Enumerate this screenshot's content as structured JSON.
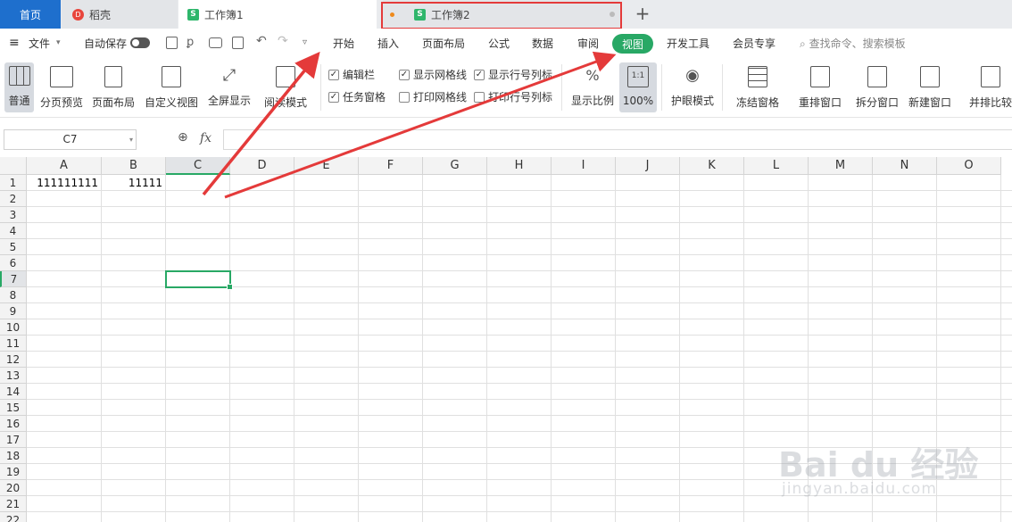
{
  "tabs": {
    "home": "首页",
    "daoke": "稻壳",
    "wb1": "工作簿1",
    "wb2": "工作簿2",
    "add": "+"
  },
  "menu": {
    "file": "文件",
    "autosave": "自动保存",
    "items": [
      "开始",
      "插入",
      "页面布局",
      "公式",
      "数据",
      "审阅",
      "视图",
      "开发工具",
      "会员专享"
    ],
    "search": "查找命令、搜索模板"
  },
  "ribbon": {
    "buttons": [
      "普通",
      "分页预览",
      "页面布局",
      "自定义视图",
      "全屏显示",
      "阅读模式"
    ],
    "checks_row1": [
      "编辑栏",
      "显示网格线",
      "显示行号列标"
    ],
    "checks_row2": [
      "任务窗格",
      "打印网格线",
      "打印行号列标"
    ],
    "zoom_buttons": [
      "显示比例",
      "100%"
    ],
    "zoom_icon_label": "1:1",
    "right_buttons": [
      "护眼模式",
      "冻结窗格",
      "重排窗口",
      "拆分窗口",
      "新建窗口",
      "并排比较"
    ]
  },
  "formula": {
    "namebox": "C7",
    "fx": "fx",
    "value": ""
  },
  "sheet": {
    "columns": [
      "A",
      "B",
      "C",
      "D",
      "E",
      "F",
      "G",
      "H",
      "I",
      "J",
      "K",
      "L",
      "M",
      "N",
      "O"
    ],
    "rows": [
      "1",
      "2",
      "3",
      "4",
      "5",
      "6",
      "7",
      "8",
      "9",
      "10",
      "11",
      "12",
      "13",
      "14",
      "15",
      "16",
      "17",
      "18",
      "19",
      "20",
      "21",
      "22"
    ],
    "selected_col": "C",
    "selected_row": "7",
    "cells": {
      "A1": "111111111",
      "B1": "11111"
    }
  },
  "colors": {
    "accent": "#28a865",
    "highlight": "#e43a3a",
    "home_tab": "#1e6fcd"
  },
  "watermark": {
    "line1": "Bai du 经验",
    "line2": "jingyan.baidu.com"
  }
}
